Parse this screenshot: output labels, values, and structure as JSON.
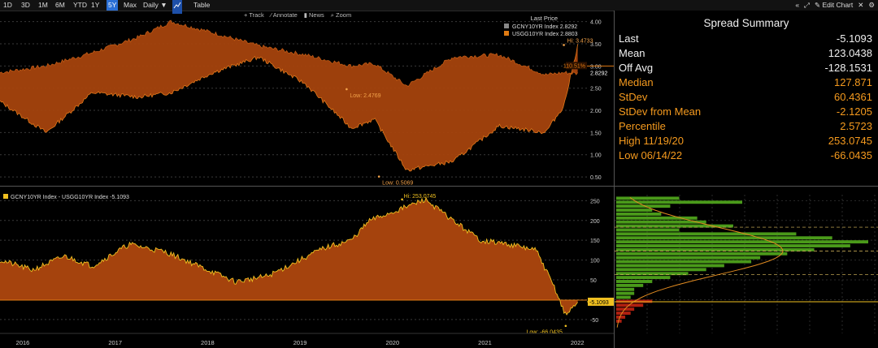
{
  "toolbar": {
    "ranges": [
      "1D",
      "3D",
      "1M",
      "6M",
      "YTD",
      "1Y",
      "5Y",
      "Max"
    ],
    "selected_range": "5Y",
    "frequency": "Daily ▼",
    "chart_icon": "line-chart-icon",
    "table_label": "Table",
    "right_items": [
      "«",
      "⤢",
      "✎ Edit Chart",
      "✕",
      "⚙"
    ]
  },
  "subtoolbar": {
    "items": [
      "+ Track",
      "⁄ Annotate",
      "▮ News",
      "⌕ Zoom"
    ]
  },
  "top_legend": {
    "header": "Last Price",
    "series": [
      {
        "name": "GCNY10YR Index",
        "value": "2.8292",
        "color": "#888888"
      },
      {
        "name": "USGG10YR Index",
        "value": "2.8803",
        "color": "#e07a12"
      }
    ]
  },
  "bottom_legend": {
    "name": "GCNY10YR Index - USGG10YR Index",
    "value": "-5.1093",
    "color": "#f0c020"
  },
  "summary": {
    "title": "Spread Summary",
    "rows": [
      {
        "label": "Last",
        "value": "-5.1093",
        "color": "white"
      },
      {
        "label": "Mean",
        "value": "123.0438",
        "color": "white"
      },
      {
        "label": "Off Avg",
        "value": "-128.1531",
        "color": "white"
      },
      {
        "label": "Median",
        "value": "127.871",
        "color": "orange"
      },
      {
        "label": "StDev",
        "value": "60.4361",
        "color": "orange"
      },
      {
        "label": "StDev from Mean",
        "value": "-2.1205",
        "color": "orange"
      },
      {
        "label": "Percentile",
        "value": "2.5723",
        "color": "orange"
      },
      {
        "label": "High 11/19/20",
        "value": "253.0745",
        "color": "orange"
      },
      {
        "label": "Low 06/14/22",
        "value": "-66.0435",
        "color": "orange"
      }
    ]
  },
  "chart_data": [
    {
      "type": "area",
      "series": [
        {
          "name": "GCNY10YR Index",
          "x": [
            2016.0,
            2016.5,
            2017.0,
            2017.5,
            2017.85,
            2018.3,
            2018.8,
            2019.3,
            2019.8,
            2020.05,
            2020.4,
            2020.9,
            2021.4,
            2021.9,
            2022.1,
            2022.25
          ],
          "values": [
            2.85,
            3.0,
            3.3,
            3.65,
            4.0,
            3.75,
            3.45,
            3.25,
            3.0,
            3.05,
            2.55,
            3.2,
            3.25,
            2.8,
            2.85,
            2.83
          ]
        },
        {
          "name": "USGG10YR Index",
          "x": [
            2016.0,
            2016.5,
            2017.0,
            2017.5,
            2017.85,
            2018.3,
            2018.8,
            2019.3,
            2019.8,
            2020.05,
            2020.4,
            2020.9,
            2021.4,
            2021.9,
            2022.1,
            2022.25
          ],
          "values": [
            2.2,
            1.5,
            2.4,
            2.3,
            2.4,
            2.85,
            3.2,
            2.6,
            1.6,
            1.8,
            0.65,
            0.85,
            1.65,
            1.5,
            2.1,
            3.47
          ]
        }
      ],
      "yticks": [
        0.5,
        1.0,
        1.5,
        2.0,
        2.5,
        3.0,
        3.5,
        4.0
      ],
      "ylim": [
        0.3,
        4.25
      ],
      "xlim": [
        2016.0,
        2022.35
      ],
      "annotations": [
        {
          "text": "Hi: 3.4733",
          "x": 2022.1,
          "y": 3.4733
        },
        {
          "text": "Low: 2.4769",
          "x": 2019.75,
          "y": 2.4769
        },
        {
          "text": "Low: 0.5069",
          "x": 2020.1,
          "y": 0.5069
        }
      ],
      "right_labels": [
        {
          "text": "110.51%",
          "y": 3.0
        },
        {
          "text": "2.8292",
          "y": 2.83
        }
      ]
    },
    {
      "type": "area",
      "series": [
        {
          "name": "GCNY10YR Index - USGG10YR Index",
          "x": [
            2016.0,
            2016.35,
            2016.7,
            2017.0,
            2017.4,
            2017.8,
            2018.2,
            2018.55,
            2018.9,
            2019.2,
            2019.5,
            2019.8,
            2020.0,
            2020.35,
            2020.6,
            2020.9,
            2021.2,
            2021.5,
            2021.8,
            2022.0,
            2022.12,
            2022.25
          ],
          "values": [
            100,
            75,
            110,
            85,
            140,
            120,
            80,
            45,
            60,
            95,
            130,
            150,
            200,
            230,
            253,
            200,
            150,
            140,
            125,
            30,
            -40,
            -5.1
          ]
        }
      ],
      "yticks": [
        -50,
        0,
        50,
        100,
        150,
        200,
        250
      ],
      "ylim": [
        -85,
        265
      ],
      "xticks": [
        "2016",
        "2017",
        "2018",
        "2019",
        "2020",
        "2021",
        "2022"
      ],
      "annotations": [
        {
          "text": "Hi: 253.0745",
          "x": 2020.35,
          "y": 253.0745
        },
        {
          "text": "Low: -66.0435",
          "x": 2022.12,
          "y": -66.0435
        }
      ],
      "last_label": "-5.1093",
      "histogram": {
        "bins": [
          250,
          240,
          230,
          220,
          210,
          200,
          190,
          180,
          170,
          160,
          150,
          140,
          130,
          120,
          110,
          100,
          90,
          80,
          70,
          60,
          50,
          40,
          30,
          20,
          10,
          0,
          -10,
          -20,
          -30,
          -40,
          -50,
          -60
        ],
        "counts": [
          35,
          70,
          30,
          20,
          25,
          45,
          50,
          65,
          35,
          100,
          120,
          140,
          130,
          110,
          95,
          80,
          75,
          60,
          50,
          40,
          30,
          20,
          15,
          10,
          10,
          8,
          20,
          15,
          10,
          8,
          5,
          3
        ]
      }
    }
  ]
}
